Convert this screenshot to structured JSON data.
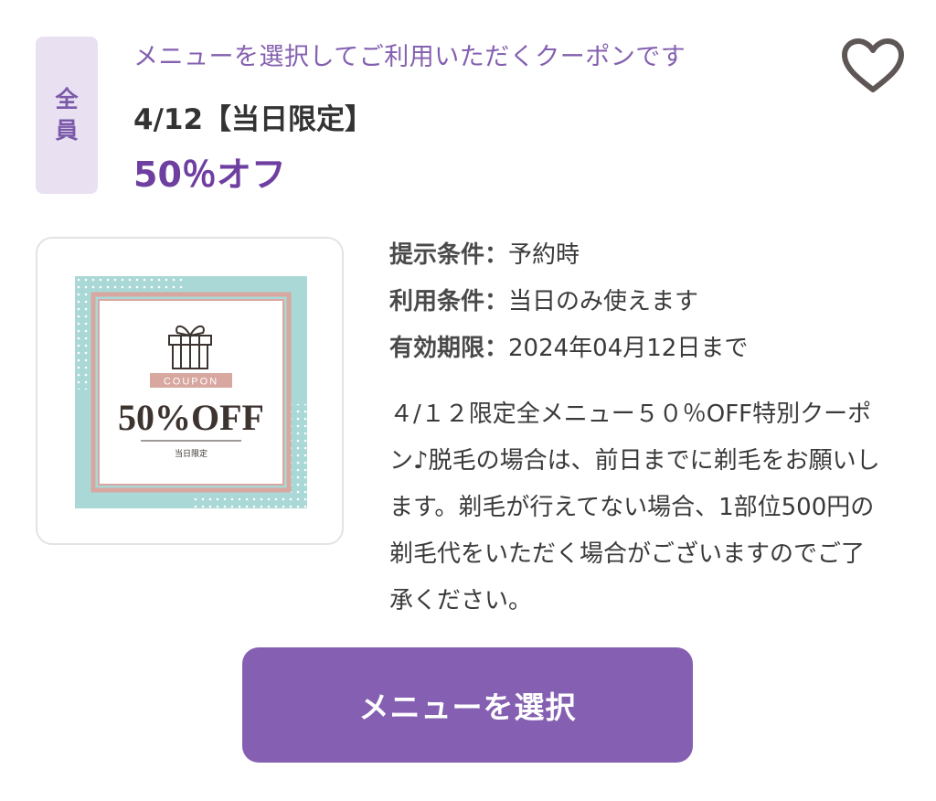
{
  "badge": {
    "line1": "全",
    "line2": "員"
  },
  "header": {
    "subtitle": "メニューを選択してご利用いただくクーポンです",
    "title": "4/12【当日限定】",
    "discount": "50％オフ"
  },
  "coupon_image": {
    "tag": "COUPON",
    "headline": "50%OFF",
    "caption": "当日限定"
  },
  "conditions": [
    {
      "label": "提示条件：",
      "value": "予約時"
    },
    {
      "label": "利用条件：",
      "value": "当日のみ使えます"
    },
    {
      "label": "有効期限：",
      "value": "2024年04月12日まで"
    }
  ],
  "description": "４/１２限定全メニュー５０％OFF特別クーポン♪脱毛の場合は、前日までに剃毛をお願いします。剃毛が行えてない場合、1部位500円の剃毛代をいただく場合がございますのでご了承ください。",
  "action": {
    "button_label": "メニューを選択"
  },
  "icons": {
    "favorite": "heart-icon",
    "gift": "gift-box-icon"
  },
  "colors": {
    "accent": "#8560b2",
    "badge_bg": "#e9e0f2",
    "coupon_teal": "#a9d8d6",
    "coupon_pink": "#d7a7a0"
  }
}
